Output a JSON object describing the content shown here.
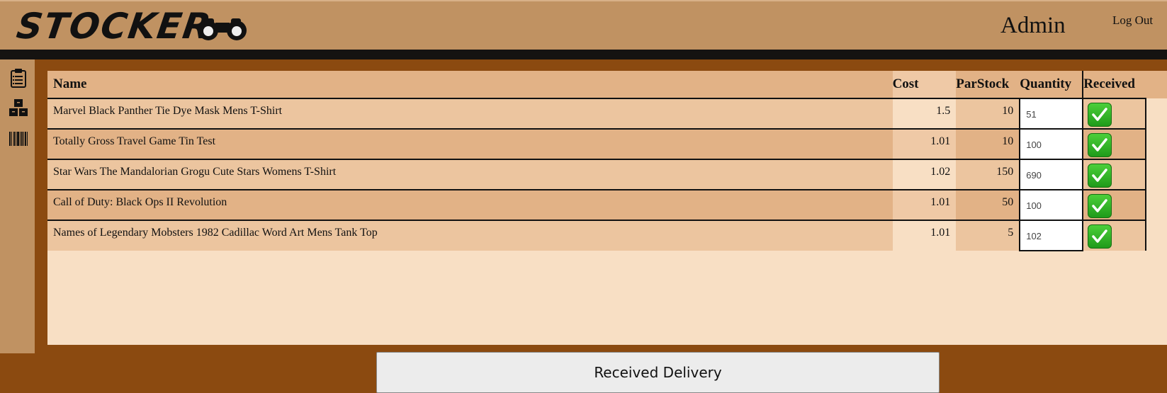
{
  "header": {
    "logo_text": "STOCKER",
    "user_label": "Admin",
    "logout_label": "Log Out"
  },
  "sidebar": {
    "items": [
      {
        "icon": "clipboard-icon"
      },
      {
        "icon": "boxes-icon"
      },
      {
        "icon": "barcode-icon"
      }
    ]
  },
  "table": {
    "headers": {
      "name": "Name",
      "cost": "Cost",
      "parstock": "ParStock",
      "quantity": "Quantity",
      "received": "Received"
    },
    "rows": [
      {
        "name": "Marvel Black Panther Tie Dye Mask Mens T-Shirt",
        "cost": "1.5",
        "parstock": "10",
        "quantity": "51",
        "received": true
      },
      {
        "name": "Totally Gross Travel Game Tin Test",
        "cost": "1.01",
        "parstock": "10",
        "quantity": "100",
        "received": true
      },
      {
        "name": "Star Wars The Mandalorian Grogu Cute Stars Womens T-Shirt",
        "cost": "1.02",
        "parstock": "150",
        "quantity": "690",
        "received": true
      },
      {
        "name": "Call of Duty: Black Ops II Revolution",
        "cost": "1.01",
        "parstock": "50",
        "quantity": "100",
        "received": true
      },
      {
        "name": "Names of Legendary Mobsters 1982 Cadillac Word Art Mens Tank Top",
        "cost": "1.01",
        "parstock": "5",
        "quantity": "102",
        "received": true
      }
    ]
  },
  "actions": {
    "submit_label": "Received Delivery"
  },
  "colors": {
    "header_bg": "#c09262",
    "frame": "#8b4a10",
    "content_bg": "#f8dfc4",
    "check_green": "#2aae22"
  }
}
